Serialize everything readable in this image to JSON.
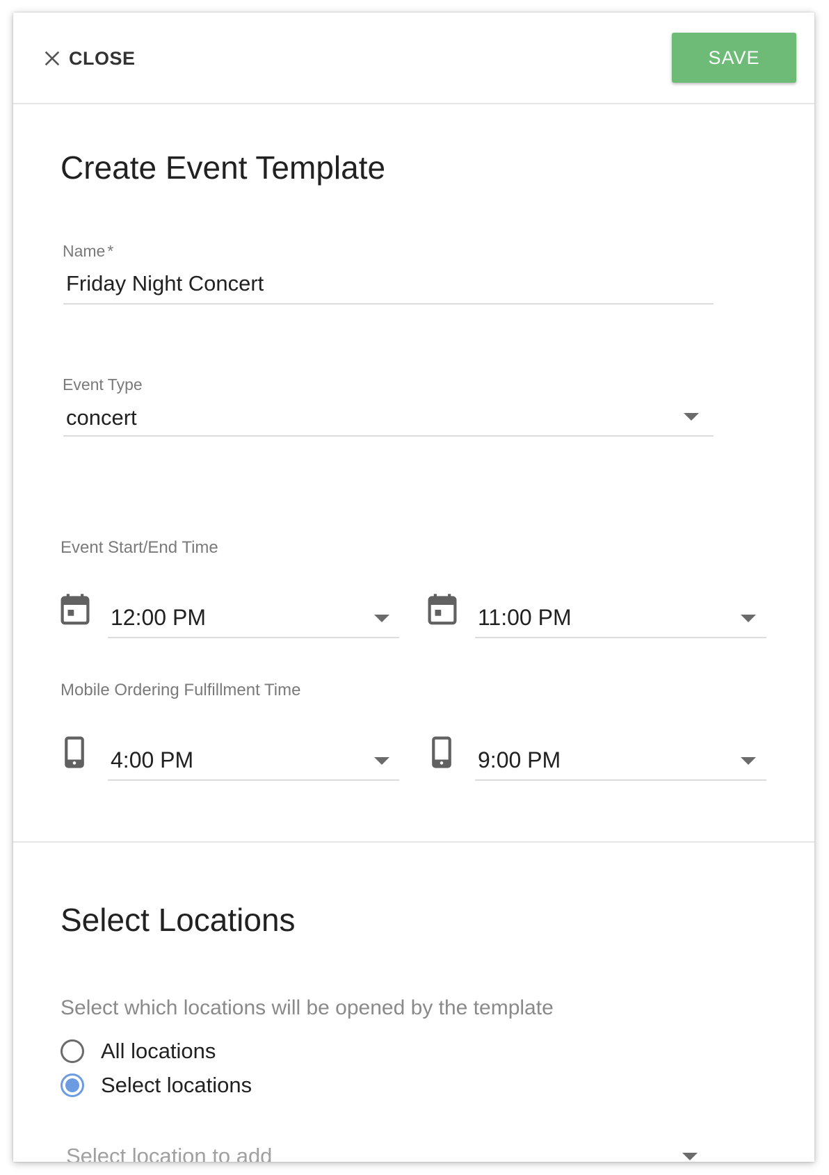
{
  "topbar": {
    "close_label": "CLOSE",
    "save_label": "SAVE"
  },
  "form": {
    "title": "Create Event Template",
    "name": {
      "label": "Name",
      "required_marker": "*",
      "value": "Friday Night Concert"
    },
    "event_type": {
      "label": "Event Type",
      "value": "concert"
    },
    "event_time": {
      "label": "Event Start/End Time",
      "start": "12:00 PM",
      "end": "11:00 PM"
    },
    "mobile_time": {
      "label": "Mobile Ordering Fulfillment Time",
      "start": "4:00 PM",
      "end": "9:00 PM"
    }
  },
  "locations": {
    "title": "Select Locations",
    "helper": "Select which locations will be opened by the template",
    "options": [
      {
        "label": "All locations",
        "checked": false
      },
      {
        "label": "Select locations",
        "checked": true
      }
    ],
    "add_placeholder": "Select location to add"
  },
  "colors": {
    "save": "#6dbb77",
    "radio_active": "#6b9be0"
  },
  "icons": [
    "close-icon",
    "calendar-icon",
    "smartphone-icon",
    "dropdown-caret-icon"
  ]
}
